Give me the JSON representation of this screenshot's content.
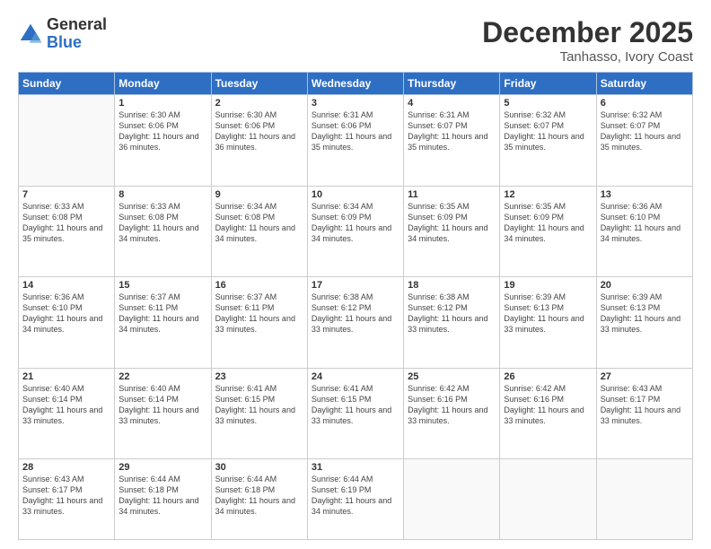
{
  "logo": {
    "general": "General",
    "blue": "Blue"
  },
  "title": "December 2025",
  "location": "Tanhasso, Ivory Coast",
  "days_of_week": [
    "Sunday",
    "Monday",
    "Tuesday",
    "Wednesday",
    "Thursday",
    "Friday",
    "Saturday"
  ],
  "weeks": [
    [
      {
        "day": "",
        "info": ""
      },
      {
        "day": "1",
        "info": "Sunrise: 6:30 AM\nSunset: 6:06 PM\nDaylight: 11 hours\nand 36 minutes."
      },
      {
        "day": "2",
        "info": "Sunrise: 6:30 AM\nSunset: 6:06 PM\nDaylight: 11 hours\nand 36 minutes."
      },
      {
        "day": "3",
        "info": "Sunrise: 6:31 AM\nSunset: 6:06 PM\nDaylight: 11 hours\nand 35 minutes."
      },
      {
        "day": "4",
        "info": "Sunrise: 6:31 AM\nSunset: 6:07 PM\nDaylight: 11 hours\nand 35 minutes."
      },
      {
        "day": "5",
        "info": "Sunrise: 6:32 AM\nSunset: 6:07 PM\nDaylight: 11 hours\nand 35 minutes."
      },
      {
        "day": "6",
        "info": "Sunrise: 6:32 AM\nSunset: 6:07 PM\nDaylight: 11 hours\nand 35 minutes."
      }
    ],
    [
      {
        "day": "7",
        "info": "Sunrise: 6:33 AM\nSunset: 6:08 PM\nDaylight: 11 hours\nand 35 minutes."
      },
      {
        "day": "8",
        "info": "Sunrise: 6:33 AM\nSunset: 6:08 PM\nDaylight: 11 hours\nand 34 minutes."
      },
      {
        "day": "9",
        "info": "Sunrise: 6:34 AM\nSunset: 6:08 PM\nDaylight: 11 hours\nand 34 minutes."
      },
      {
        "day": "10",
        "info": "Sunrise: 6:34 AM\nSunset: 6:09 PM\nDaylight: 11 hours\nand 34 minutes."
      },
      {
        "day": "11",
        "info": "Sunrise: 6:35 AM\nSunset: 6:09 PM\nDaylight: 11 hours\nand 34 minutes."
      },
      {
        "day": "12",
        "info": "Sunrise: 6:35 AM\nSunset: 6:09 PM\nDaylight: 11 hours\nand 34 minutes."
      },
      {
        "day": "13",
        "info": "Sunrise: 6:36 AM\nSunset: 6:10 PM\nDaylight: 11 hours\nand 34 minutes."
      }
    ],
    [
      {
        "day": "14",
        "info": "Sunrise: 6:36 AM\nSunset: 6:10 PM\nDaylight: 11 hours\nand 34 minutes."
      },
      {
        "day": "15",
        "info": "Sunrise: 6:37 AM\nSunset: 6:11 PM\nDaylight: 11 hours\nand 34 minutes."
      },
      {
        "day": "16",
        "info": "Sunrise: 6:37 AM\nSunset: 6:11 PM\nDaylight: 11 hours\nand 33 minutes."
      },
      {
        "day": "17",
        "info": "Sunrise: 6:38 AM\nSunset: 6:12 PM\nDaylight: 11 hours\nand 33 minutes."
      },
      {
        "day": "18",
        "info": "Sunrise: 6:38 AM\nSunset: 6:12 PM\nDaylight: 11 hours\nand 33 minutes."
      },
      {
        "day": "19",
        "info": "Sunrise: 6:39 AM\nSunset: 6:13 PM\nDaylight: 11 hours\nand 33 minutes."
      },
      {
        "day": "20",
        "info": "Sunrise: 6:39 AM\nSunset: 6:13 PM\nDaylight: 11 hours\nand 33 minutes."
      }
    ],
    [
      {
        "day": "21",
        "info": "Sunrise: 6:40 AM\nSunset: 6:14 PM\nDaylight: 11 hours\nand 33 minutes."
      },
      {
        "day": "22",
        "info": "Sunrise: 6:40 AM\nSunset: 6:14 PM\nDaylight: 11 hours\nand 33 minutes."
      },
      {
        "day": "23",
        "info": "Sunrise: 6:41 AM\nSunset: 6:15 PM\nDaylight: 11 hours\nand 33 minutes."
      },
      {
        "day": "24",
        "info": "Sunrise: 6:41 AM\nSunset: 6:15 PM\nDaylight: 11 hours\nand 33 minutes."
      },
      {
        "day": "25",
        "info": "Sunrise: 6:42 AM\nSunset: 6:16 PM\nDaylight: 11 hours\nand 33 minutes."
      },
      {
        "day": "26",
        "info": "Sunrise: 6:42 AM\nSunset: 6:16 PM\nDaylight: 11 hours\nand 33 minutes."
      },
      {
        "day": "27",
        "info": "Sunrise: 6:43 AM\nSunset: 6:17 PM\nDaylight: 11 hours\nand 33 minutes."
      }
    ],
    [
      {
        "day": "28",
        "info": "Sunrise: 6:43 AM\nSunset: 6:17 PM\nDaylight: 11 hours\nand 33 minutes."
      },
      {
        "day": "29",
        "info": "Sunrise: 6:44 AM\nSunset: 6:18 PM\nDaylight: 11 hours\nand 34 minutes."
      },
      {
        "day": "30",
        "info": "Sunrise: 6:44 AM\nSunset: 6:18 PM\nDaylight: 11 hours\nand 34 minutes."
      },
      {
        "day": "31",
        "info": "Sunrise: 6:44 AM\nSunset: 6:19 PM\nDaylight: 11 hours\nand 34 minutes."
      },
      {
        "day": "",
        "info": ""
      },
      {
        "day": "",
        "info": ""
      },
      {
        "day": "",
        "info": ""
      }
    ]
  ]
}
